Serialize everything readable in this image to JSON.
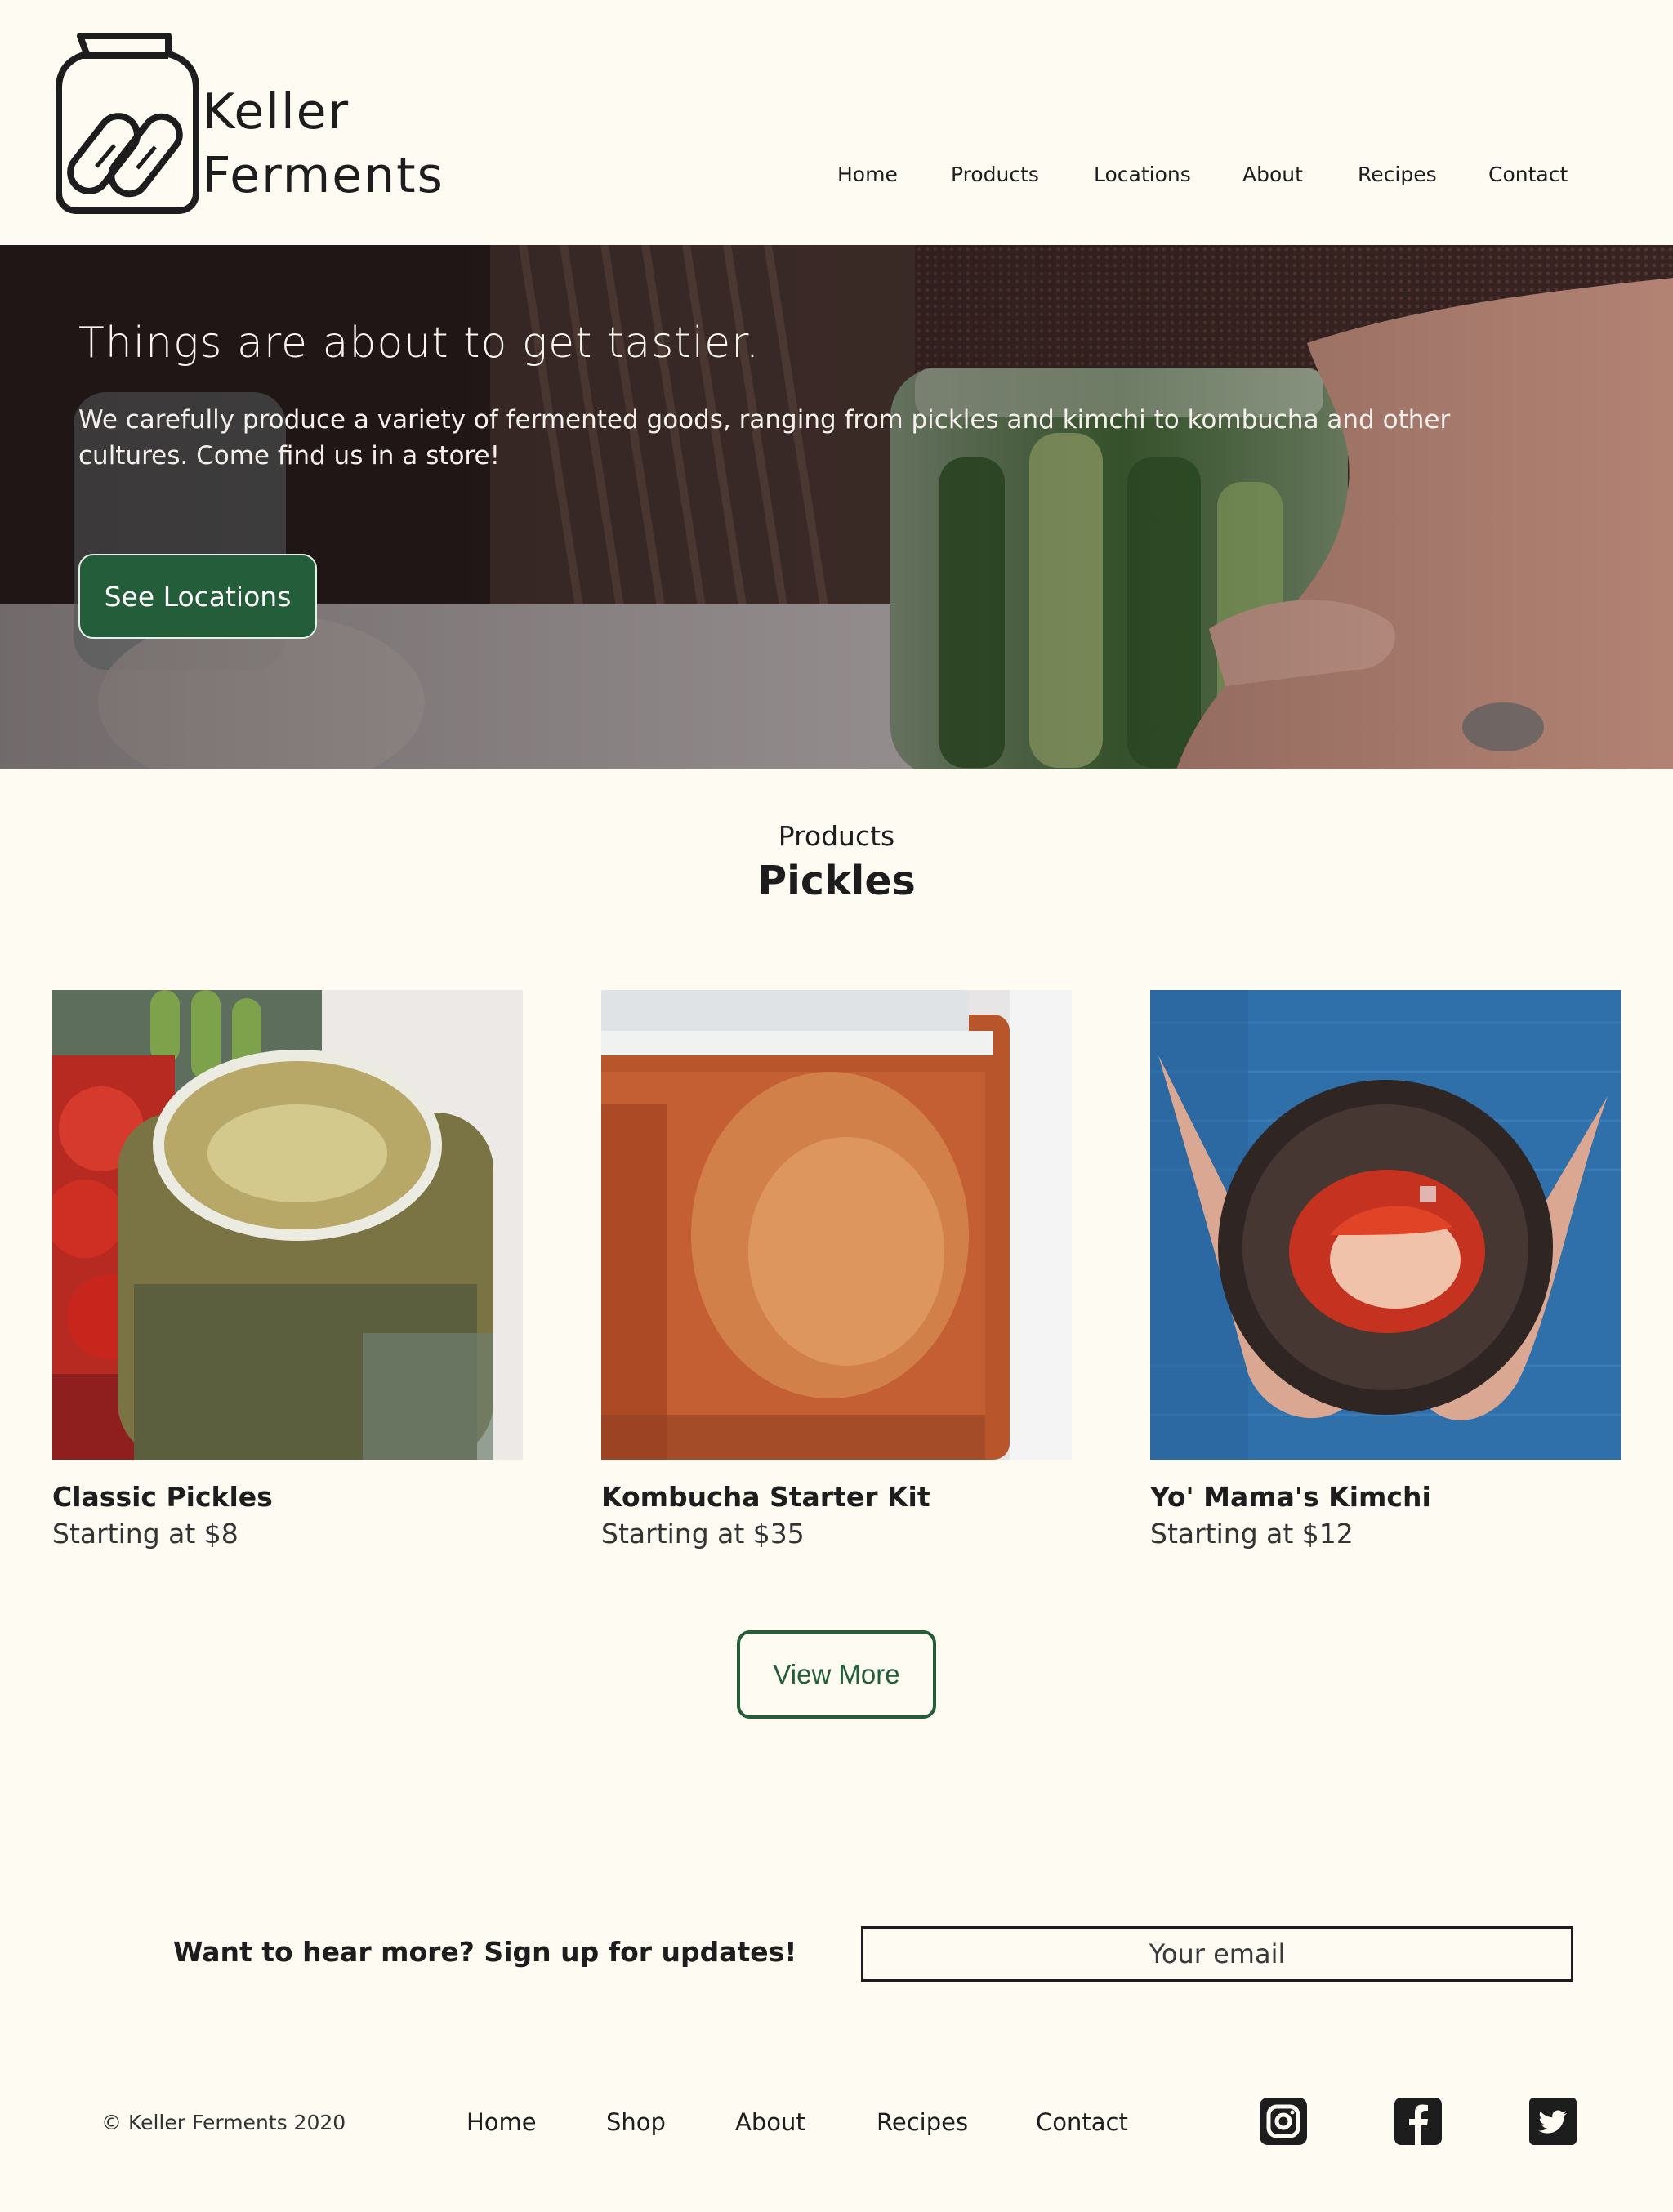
{
  "brand": {
    "line1": "Keller",
    "line2": "Ferments"
  },
  "nav": [
    "Home",
    "Products",
    "Locations",
    "About",
    "Recipes",
    "Contact"
  ],
  "hero": {
    "title": "Things are about to get tastier.",
    "text": "We carefully produce a variety of fermented goods, ranging from pickles and kimchi to kombucha and other cultures. Come find us in a store!",
    "button": "See Locations"
  },
  "products": {
    "label": "Products",
    "title": "Pickles",
    "items": [
      {
        "name": "Classic Pickles",
        "price": "Starting at $8"
      },
      {
        "name": "Kombucha Starter Kit",
        "price": "Starting at $35"
      },
      {
        "name": "Yo' Mama's Kimchi",
        "price": "Starting at $12"
      }
    ],
    "more_button": "View More"
  },
  "signup": {
    "text": "Want to hear more? Sign up for updates!",
    "placeholder": "Your email"
  },
  "footer": {
    "copyright": "© Keller Ferments 2020",
    "links": [
      "Home",
      "Shop",
      "About",
      "Recipes",
      "Contact"
    ],
    "social": [
      "instagram-icon",
      "facebook-icon",
      "twitter-icon"
    ]
  },
  "colors": {
    "background": "#fdfbf2",
    "accent": "#235d3a",
    "text": "#1d1d1d"
  }
}
